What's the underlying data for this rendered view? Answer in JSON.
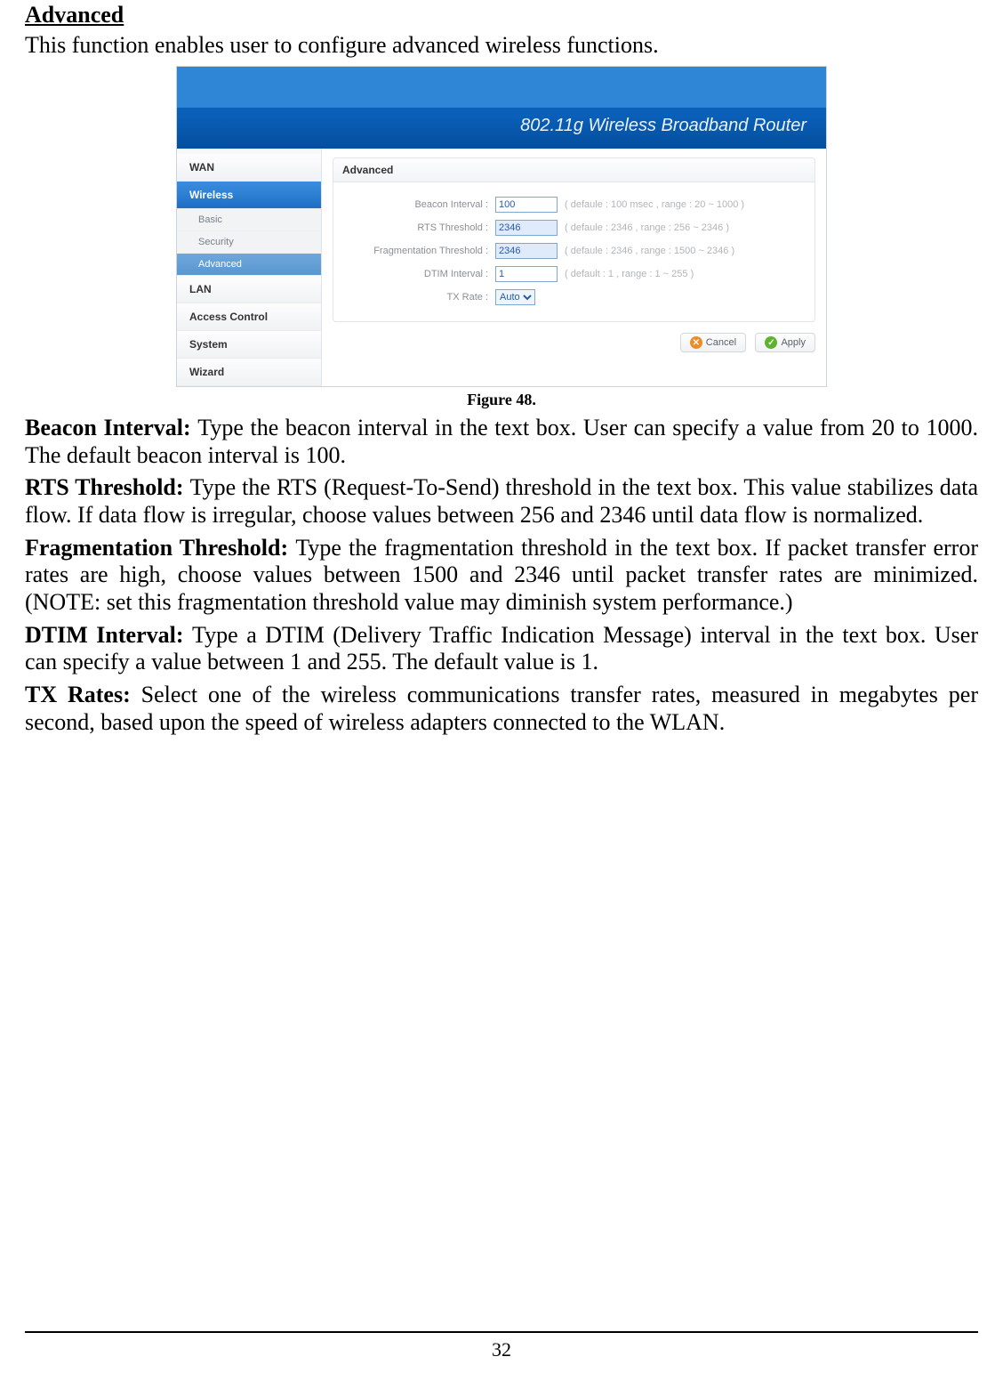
{
  "heading": "Advanced",
  "intro": "This function enables user to configure advanced wireless functions.",
  "figure": {
    "header_title": "802.11g Wireless Broadband Router",
    "sidebar": {
      "items": [
        "WAN",
        "Wireless",
        "LAN",
        "Access Control",
        "System",
        "Wizard"
      ],
      "sub": [
        "Basic",
        "Security",
        "Advanced"
      ]
    },
    "panel_title": "Advanced",
    "fields": {
      "beacon": {
        "label": "Beacon Interval :",
        "value": "100",
        "hint": "( defaule : 100 msec , range : 20 ~ 1000 )"
      },
      "rts": {
        "label": "RTS Threshold :",
        "value": "2346",
        "hint": "( defaule : 2346 , range : 256 ~ 2346 )"
      },
      "frag": {
        "label": "Fragmentation Threshold :",
        "value": "2346",
        "hint": "( defaule : 2346 , range : 1500 ~ 2346 )"
      },
      "dtim": {
        "label": "DTIM Interval :",
        "value": "1",
        "hint": "( default : 1 , range : 1 ~ 255 )"
      },
      "txrate": {
        "label": "TX Rate :",
        "value": "Auto"
      }
    },
    "buttons": {
      "cancel": "Cancel",
      "apply": "Apply"
    }
  },
  "caption": "Figure 48.",
  "body": {
    "beacon": {
      "lead": "Beacon Interval: ",
      "text": "Type the beacon interval in the text box. User can specify a value from 20 to 1000. The default beacon interval is 100."
    },
    "rts": {
      "lead": "RTS Threshold: ",
      "text": "Type the RTS (Request-To-Send) threshold in the text box. This value stabilizes data flow. If data flow is irregular, choose values between 256 and 2346 until data flow is normalized."
    },
    "frag": {
      "lead": "Fragmentation Threshold: ",
      "text": "Type the fragmentation threshold in the text box. If packet transfer error rates are high, choose values between 1500 and 2346 until packet transfer rates are minimized. (NOTE: set this fragmentation threshold value may diminish system performance.)"
    },
    "dtim": {
      "lead": "DTIM Interval: ",
      "text": "Type a DTIM (Delivery Traffic Indication Message) interval in the text box. User can specify a value between 1 and 255. The default value is 1."
    },
    "txrate": {
      "lead": "TX Rates: ",
      "text": "Select one of the wireless communications transfer rates, measured in megabytes per second, based upon the speed of wireless adapters connected to the WLAN."
    }
  },
  "page_number": "32"
}
